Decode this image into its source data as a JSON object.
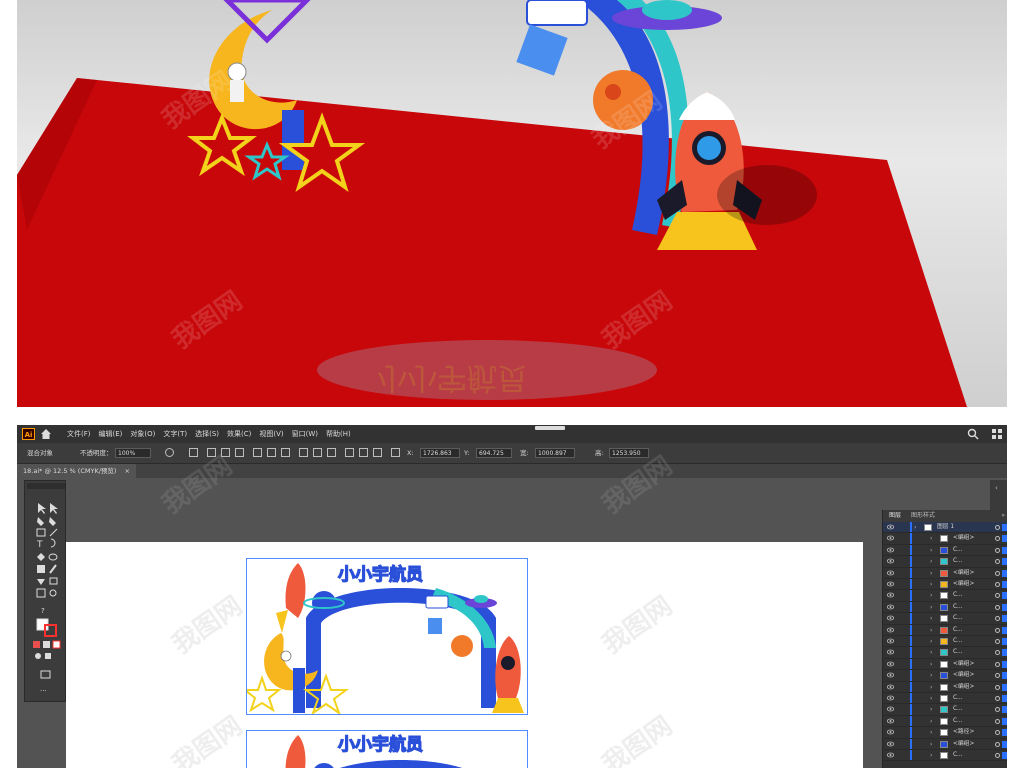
{
  "render": {
    "colors": {
      "carpet": "#c8070a",
      "arch_blue": "#2a4fd8",
      "arch_teal": "#2fc6c9",
      "rocket": "#f05a3c",
      "moon": "#f7b51e",
      "star_outline": "#f2d21a"
    },
    "watermark": "我图网"
  },
  "illustrator": {
    "logo": "Ai",
    "home_icon": "home-icon",
    "menu": [
      "文件(F)",
      "编辑(E)",
      "对象(O)",
      "文字(T)",
      "选择(S)",
      "效果(C)",
      "视图(V)",
      "窗口(W)",
      "帮助(H)"
    ],
    "control": {
      "selection_label": "混合对象",
      "opacity_label": "不透明度：",
      "opacity_value": "100%",
      "x_label": "X:",
      "x_value": "1726.863",
      "y_label": "Y:",
      "y_value": "694.725",
      "w_label": "宽:",
      "w_value": "1000.897",
      "h_label": "高:",
      "h_value": "1253.950"
    },
    "document_tab": "18.ai* @ 12.5 % (CMYK/预览)",
    "document_tab_close": "×",
    "artwork_title": "小小宇航员",
    "layers_panel": {
      "tab_layers": "图层",
      "tab_styles": "图形样式",
      "more": "»",
      "rows": [
        {
          "name": "图层 1",
          "thumb": "#ffffff"
        },
        {
          "name": "<编组>",
          "thumb": "#ffffff"
        },
        {
          "name": "C...",
          "thumb": "#2a4fd8"
        },
        {
          "name": "C...",
          "thumb": "#2fc6c9"
        },
        {
          "name": "<编组>",
          "thumb": "#f05a3c"
        },
        {
          "name": "<编组>",
          "thumb": "#f7b51e"
        },
        {
          "name": "C...",
          "thumb": "#ffffff"
        },
        {
          "name": "C...",
          "thumb": "#2a4fd8"
        },
        {
          "name": "C...",
          "thumb": "#ffffff"
        },
        {
          "name": "C...",
          "thumb": "#f05a3c"
        },
        {
          "name": "C...",
          "thumb": "#f7b51e"
        },
        {
          "name": "C...",
          "thumb": "#2fc6c9"
        },
        {
          "name": "<编组>",
          "thumb": "#ffffff"
        },
        {
          "name": "<编组>",
          "thumb": "#2a4fd8"
        },
        {
          "name": "<编组>",
          "thumb": "#ffffff"
        },
        {
          "name": "C...",
          "thumb": "#ffffff"
        },
        {
          "name": "C...",
          "thumb": "#2fc6c9"
        },
        {
          "name": "C...",
          "thumb": "#ffffff"
        },
        {
          "name": "<路径>",
          "thumb": "#ffffff"
        },
        {
          "name": "<编组>",
          "thumb": "#2a4fd8"
        },
        {
          "name": "C...",
          "thumb": "#ffffff"
        }
      ]
    }
  }
}
